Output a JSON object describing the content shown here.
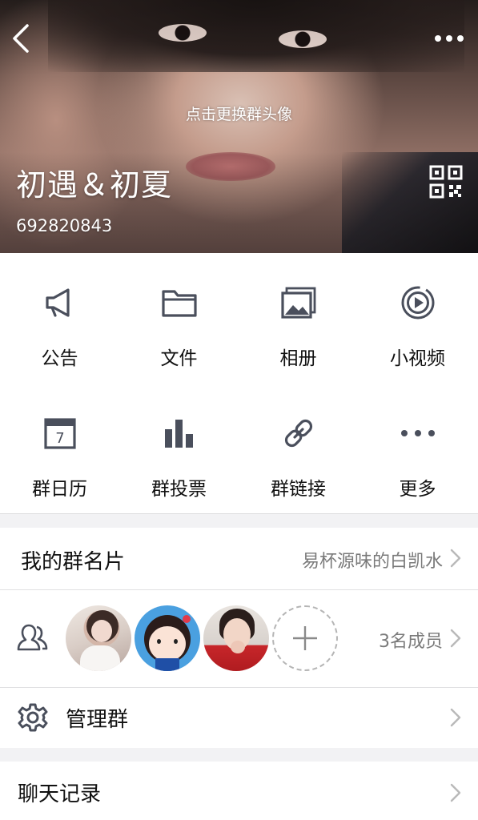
{
  "header": {
    "avatar_hint": "点击更换群头像",
    "group_name": "初遇＆初夏",
    "group_id": "692820843"
  },
  "features": [
    {
      "label": "公告",
      "icon": "megaphone-icon"
    },
    {
      "label": "文件",
      "icon": "folder-icon"
    },
    {
      "label": "相册",
      "icon": "album-icon"
    },
    {
      "label": "小视频",
      "icon": "video-icon"
    },
    {
      "label": "群日历",
      "icon": "calendar-icon",
      "calendar_day": "7"
    },
    {
      "label": "群投票",
      "icon": "bar-chart-icon"
    },
    {
      "label": "群链接",
      "icon": "link-icon"
    },
    {
      "label": "更多",
      "icon": "more-dots-icon"
    }
  ],
  "my_card": {
    "title": "我的群名片",
    "value": "易杯源味的白凯水"
  },
  "members": {
    "count_label": "3名成员"
  },
  "manage": {
    "title": "管理群"
  },
  "chat_history": {
    "title": "聊天记录"
  },
  "colors": {
    "icon_gray": "#4a4f5c",
    "value_gray": "#7a7a7a",
    "chevron_gray": "#b9b9b9",
    "avatar2_bg": "#4aa0e0"
  }
}
